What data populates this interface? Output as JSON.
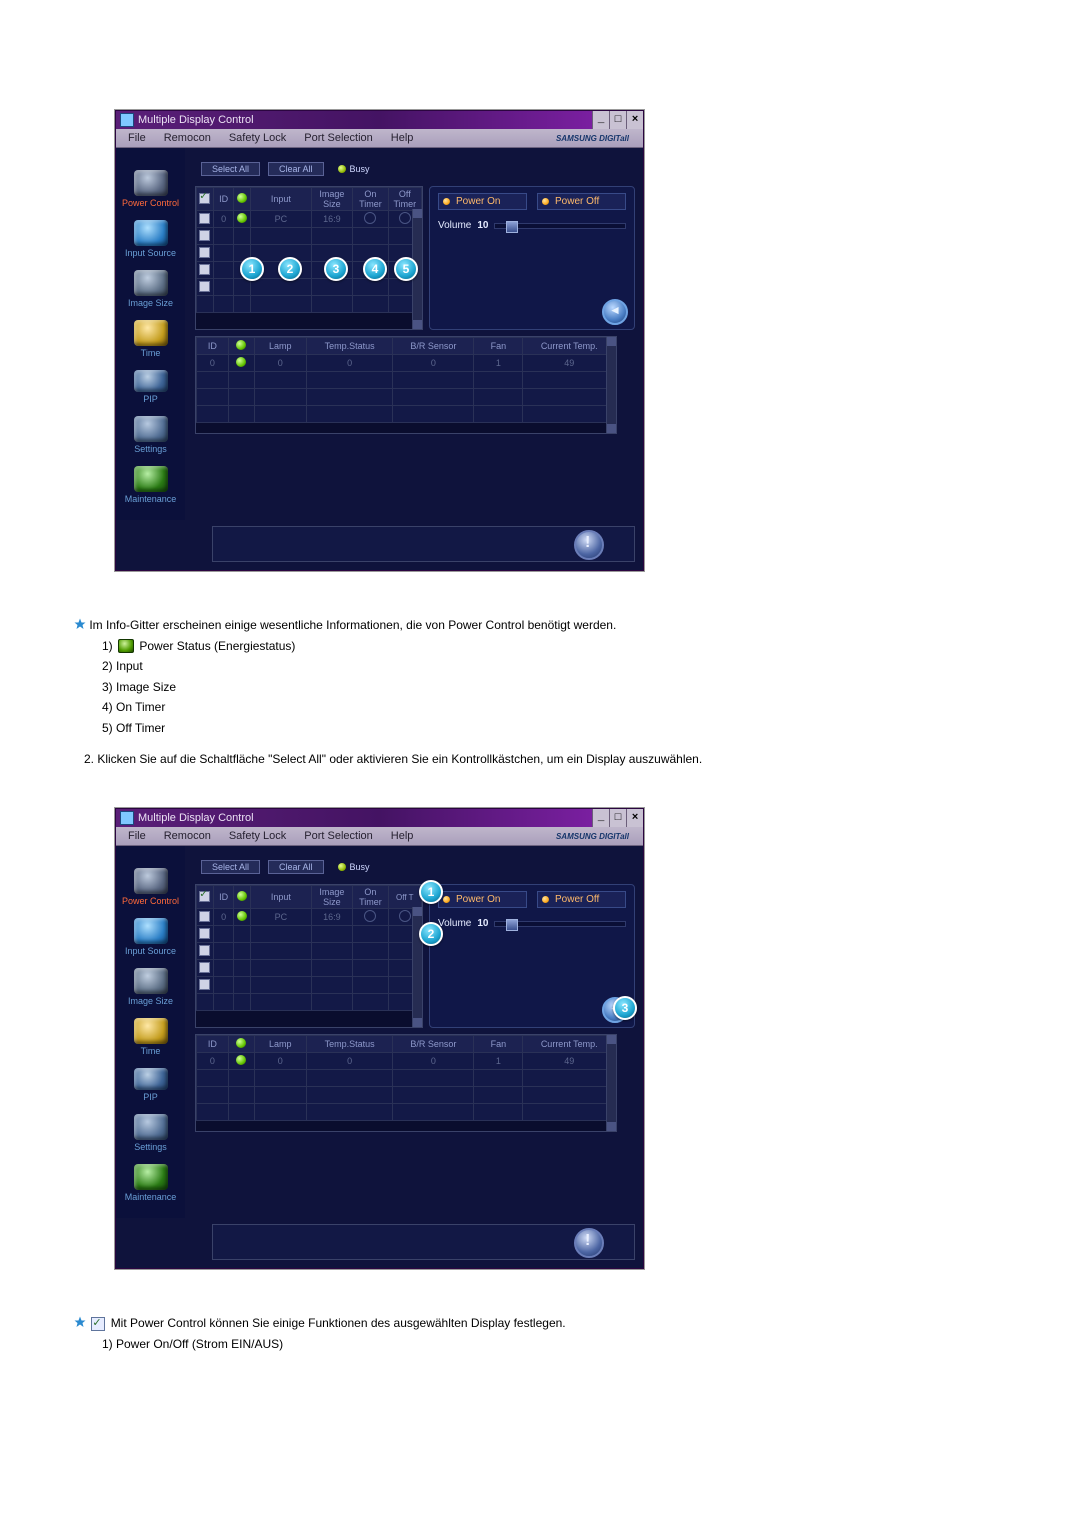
{
  "window": {
    "title": "Multiple Display Control",
    "winbtns": {
      "min": "_",
      "max": "□",
      "close": "×"
    }
  },
  "menubar": {
    "items": [
      "File",
      "Remocon",
      "Safety Lock",
      "Port Selection",
      "Help"
    ],
    "brand": "SAMSUNG DIGITall"
  },
  "sidebar": {
    "items": [
      {
        "label": "Power Control",
        "iconclass": "power"
      },
      {
        "label": "Input Source",
        "iconclass": "input"
      },
      {
        "label": "Image Size",
        "iconclass": "size"
      },
      {
        "label": "Time",
        "iconclass": "time"
      },
      {
        "label": "PIP",
        "iconclass": "pip"
      },
      {
        "label": "Settings",
        "iconclass": "settings"
      },
      {
        "label": "Maintenance",
        "iconclass": "maint"
      }
    ]
  },
  "gridtop": {
    "buttons": {
      "select_all": "Select All",
      "clear_all": "Clear All"
    },
    "busy_label": "Busy",
    "headers": {
      "id": "ID",
      "input": "Input",
      "image_size": "Image Size",
      "on_timer": "On Timer",
      "off_timer": "Off Timer"
    },
    "row": {
      "id": "0",
      "input": "PC",
      "image_size": "16:9"
    }
  },
  "gridbottom": {
    "headers": {
      "id": "ID",
      "lamp": "Lamp",
      "temp_status": "Temp.Status",
      "br_sensor": "B/R Sensor",
      "fan": "Fan",
      "current_temp": "Current Temp."
    },
    "row": {
      "id": "0",
      "lamp": "0",
      "temp_status": "0",
      "br_sensor": "0",
      "fan": "1",
      "current_temp": "49"
    }
  },
  "panel": {
    "power_on": "Power On",
    "power_off": "Power Off",
    "volume_label": "Volume",
    "volume_value": "10"
  },
  "intertext": {
    "bullet1_intro": "Im Info-Gitter erscheinen einige wesentliche Informationen, die von Power Control benötigt werden.",
    "li1a": "1)",
    "li1b": "Power Status (Energiestatus)",
    "li2": "2) Input",
    "li3": "3) Image Size",
    "li4": "4) On Timer",
    "li5": "5) Off Timer",
    "para2": "2.  Klicken Sie auf die Schaltfläche \"Select All\" oder aktivieren Sie ein Kontrollkästchen, um ein Display auszuwählen.",
    "bullet2_intro": "Mit Power Control können Sie einige Funktionen des ausgewählten Display festlegen.",
    "li2_1": "1)  Power On/Off (Strom EIN/AUS)"
  }
}
